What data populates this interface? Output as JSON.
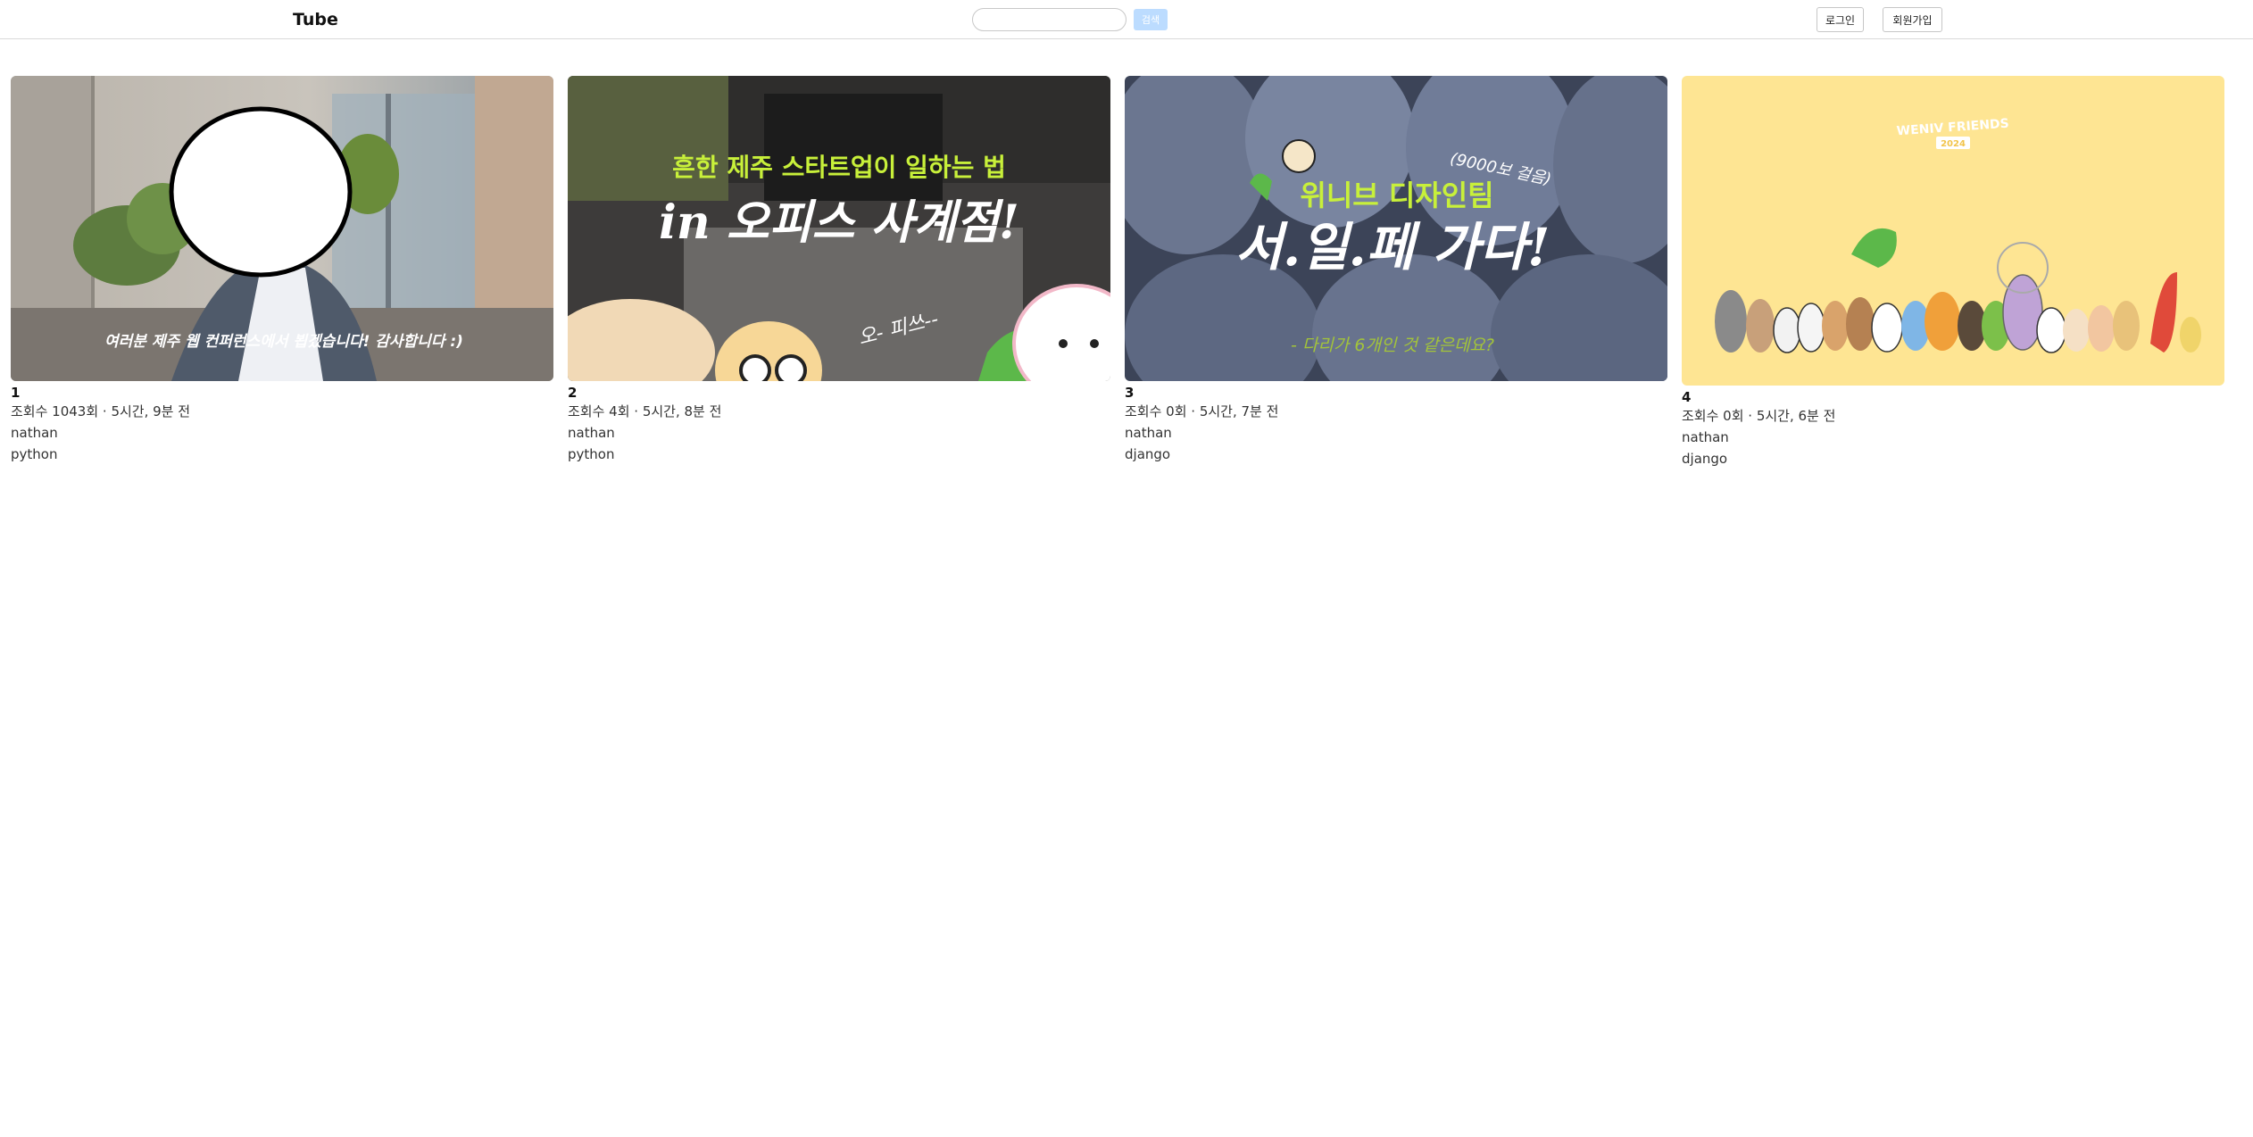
{
  "header": {
    "logo": "Tube",
    "search_placeholder": "",
    "search_button": "검색",
    "login_button": "로그인",
    "signup_button": "회원가입"
  },
  "videos": [
    {
      "id": "1",
      "views_time": "조회수 1043회 · 5시간, 9분 전",
      "author": "nathan",
      "tag": "python",
      "thumb_caption": "여러분 제주 웹 컨퍼런스에서 뵙겠습니다! 감사합니다 :)"
    },
    {
      "id": "2",
      "views_time": "조회수 4회 · 5시간, 8분 전",
      "author": "nathan",
      "tag": "python",
      "thumb_line1": "흔한 제주 스타트업이 일하는 법",
      "thumb_line2": "in 오피스 사계점!",
      "thumb_line3": "오- 피쓰--"
    },
    {
      "id": "3",
      "views_time": "조회수 0회 · 5시간, 7분 전",
      "author": "nathan",
      "tag": "django",
      "thumb_line1": "위니브 디자인팀",
      "thumb_line2": "서.일.페 가다!",
      "thumb_line3": "(9000보 걸음)",
      "thumb_line4": "- 다리가 6개인 것 같은데요?"
    },
    {
      "id": "4",
      "views_time": "조회수 0회 · 5시간, 6분 전",
      "author": "nathan",
      "tag": "django",
      "thumb_line1": "WENIV FRIENDS",
      "thumb_line2": "2024"
    }
  ]
}
